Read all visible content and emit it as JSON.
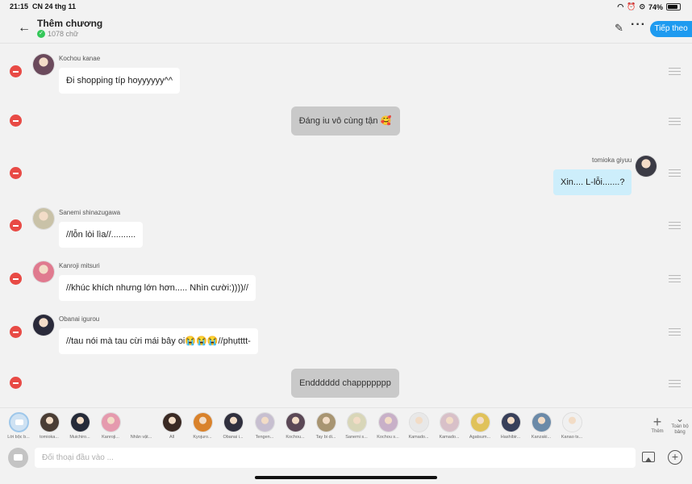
{
  "status_bar": {
    "time": "21:15",
    "date": "CN 24 thg 11",
    "battery": "74%",
    "battery_fraction": 0.74
  },
  "header": {
    "title": "Thêm chương",
    "word_count": "1078 chữ",
    "next_label": "Tiếp theo"
  },
  "messages": [
    {
      "type": "char",
      "name": "Kochou kanae",
      "text": "Đi shopping típ hoyyyyyy^^",
      "side": "left",
      "avatar_color": "#6b4a5c"
    },
    {
      "type": "narration",
      "text": "Đáng iu vô cùng tận 🥰"
    },
    {
      "type": "char",
      "name": "tomioka giyuu",
      "text": "Xin.... L-lỗi.......?",
      "side": "right",
      "avatar_color": "#3b3b45"
    },
    {
      "type": "char",
      "name": "Sanemi shinazugawa",
      "text": "//lỗn lòi lìa//..........",
      "side": "left",
      "avatar_color": "#c9c2a8"
    },
    {
      "type": "char",
      "name": "Kanroji mitsuri",
      "text": "//khúc khích nhưng lớn hơn..... Nhìn cười:))))//",
      "side": "left",
      "avatar_color": "#e07a8f"
    },
    {
      "type": "char",
      "name": "Obanai igurou",
      "text": "//tau nói mà tau cừi mái bây oi😭😭😭//phụtttt-",
      "side": "left",
      "avatar_color": "#2a2a3a"
    },
    {
      "type": "narration",
      "text": "Endddddd chappppppp"
    }
  ],
  "character_bar": {
    "chips": [
      {
        "label": "Lời bộc b...",
        "color": "#cfe2f3"
      },
      {
        "label": "tomioka...",
        "color": "#4a3d35"
      },
      {
        "label": "Muichiro...",
        "color": "#252a38"
      },
      {
        "label": "Kanroji...",
        "color": "#e59aae"
      },
      {
        "label": "Nhân vật...",
        "color": "#f2f2f2"
      },
      {
        "label": "All",
        "color": "#3a2a24"
      },
      {
        "label": "Kyojuro...",
        "color": "#d9822b"
      },
      {
        "label": "Obanai i...",
        "color": "#30303e"
      },
      {
        "label": "Tengen...",
        "color": "#c7bfd0"
      },
      {
        "label": "Kochou...",
        "color": "#5b4856"
      },
      {
        "label": "Tay bi di...",
        "color": "#a89572"
      },
      {
        "label": "Sanemi s...",
        "color": "#d8d6b8"
      },
      {
        "label": "Kochou s...",
        "color": "#c8b0c8"
      },
      {
        "label": "Kamado...",
        "color": "#e8e8e8"
      },
      {
        "label": "Kamado...",
        "color": "#d8c0c8"
      },
      {
        "label": "Agatsum...",
        "color": "#e0c25a"
      },
      {
        "label": "Hashibir...",
        "color": "#38405a"
      },
      {
        "label": "Kanzaki...",
        "color": "#6b8aa8"
      },
      {
        "label": "Kanao ts...",
        "color": "#f0f0f0"
      }
    ],
    "add_label": "Thêm",
    "collapse_label": "Toàn bộ bảng"
  },
  "input_bar": {
    "placeholder": "Đối thoại đầu vào ..."
  }
}
